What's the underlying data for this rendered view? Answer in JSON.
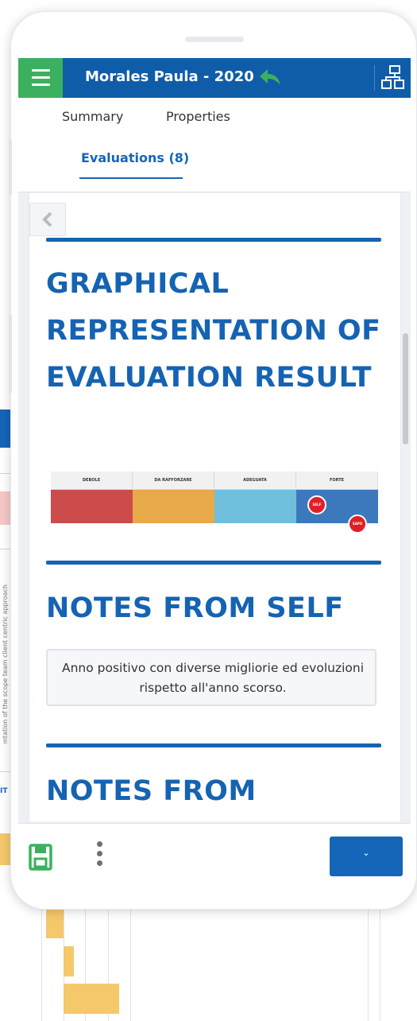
{
  "header": {
    "title": "Morales Paula - 2020",
    "menu_icon": "hamburger-menu-icon",
    "back_icon": "reply-arrow-icon",
    "org_icon": "org-chart-icon"
  },
  "tabs": [
    {
      "label": "Summary"
    },
    {
      "label": "Properties"
    },
    {
      "label": "Evaluations (8)",
      "active": true
    }
  ],
  "content": {
    "back_icon": "chevron-left-icon",
    "graph_section": {
      "title": "GRAPHICAL REPRESENTATION OF EVALUATION RESULT"
    },
    "chart_data": {
      "type": "table",
      "categories": [
        "DEBOLE",
        "DA RAFFORZARE",
        "ADEGUATA",
        "FORTE"
      ],
      "colors": [
        "#cc4b4b",
        "#e8a94a",
        "#6fbfdc",
        "#3c79bc"
      ],
      "markers": [
        {
          "label": "SELF",
          "category": "FORTE"
        },
        {
          "label": "SAPO",
          "category": "FORTE"
        }
      ]
    },
    "self_notes": {
      "title": "NOTES FROM SELF",
      "text": "Anno positivo con diverse migliorie ed evoluzioni rispetto all'anno scorso."
    },
    "next_section": {
      "title": "NOTES FROM"
    }
  },
  "footer": {
    "save_icon": "floppy-disk-icon",
    "more_icon": "vertical-ellipsis-icon",
    "dropdown_icon": "chevron-down-icon",
    "dropdown_symbol": "⌄"
  },
  "background": {
    "vertical_text": "client orientation of the scope team client centric approach",
    "side_label": "IT"
  },
  "colors": {
    "primary": "#0f5da9",
    "accent_green": "#3bb05e",
    "heading_blue": "#1563b2"
  }
}
